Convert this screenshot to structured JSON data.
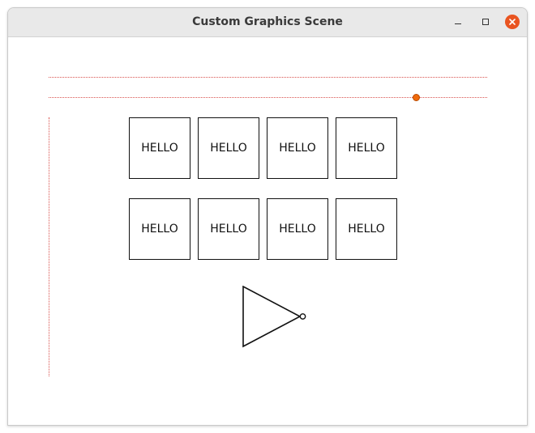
{
  "window": {
    "title": "Custom Graphics Scene",
    "controls": [
      "minimize-icon",
      "maximize-icon",
      "close-icon"
    ],
    "colors": {
      "close_button": "#e95420",
      "guide_line": "#d9534f",
      "handle": "#f06a0a"
    }
  },
  "scene": {
    "grid": {
      "rows": [
        [
          "HELLO",
          "HELLO",
          "HELLO",
          "HELLO"
        ],
        [
          "HELLO",
          "HELLO",
          "HELLO",
          "HELLO"
        ]
      ]
    },
    "gate_icon": "not-gate-icon"
  }
}
